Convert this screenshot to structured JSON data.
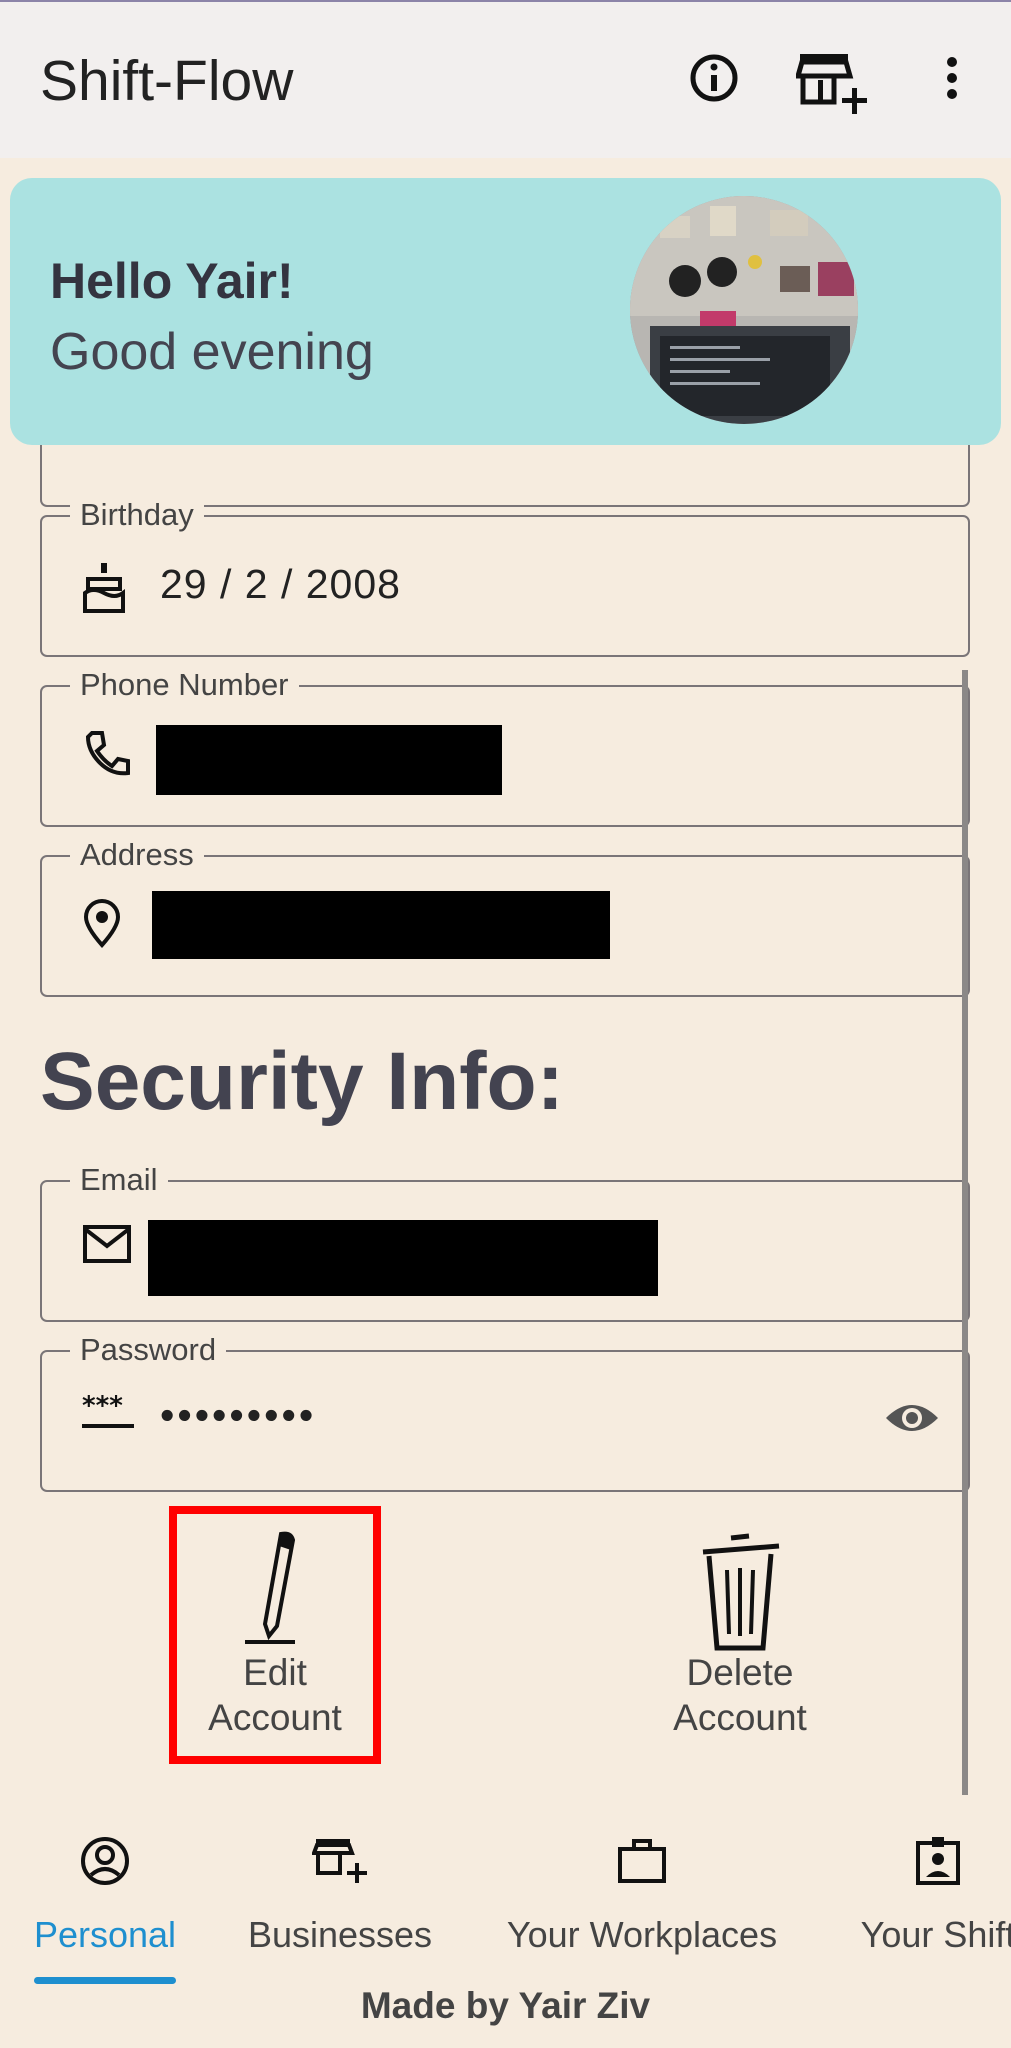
{
  "app": {
    "title": "Shift-Flow"
  },
  "top_icons": [
    "info-icon",
    "store-add-icon",
    "more-vert-icon"
  ],
  "greeting": {
    "hello": "Hello Yair!",
    "sub": "Good evening"
  },
  "fields": {
    "birthday": {
      "label": "Birthday",
      "value": "29 / 2 / 2008",
      "icon": "cake-icon"
    },
    "phone": {
      "label": "Phone Number",
      "value": "",
      "icon": "phone-icon"
    },
    "address": {
      "label": "Address",
      "value": "",
      "icon": "location-pin-icon"
    },
    "email": {
      "label": "Email",
      "value": "",
      "icon": "mail-icon"
    },
    "password": {
      "label": "Password",
      "value": "•••••••••",
      "icon": "password-icon",
      "toggle_icon": "eye-icon"
    }
  },
  "security": {
    "title": "Security Info:"
  },
  "actions": {
    "edit": {
      "line1": "Edit",
      "line2": "Account",
      "icon": "pen-icon"
    },
    "delete": {
      "line1": "Delete",
      "line2": "Account",
      "icon": "trash-icon"
    }
  },
  "nav": {
    "items": [
      {
        "label": "Personal",
        "icon": "account-circle-icon",
        "active": true
      },
      {
        "label": "Businesses",
        "icon": "store-add-icon",
        "active": false
      },
      {
        "label": "Your Workplaces",
        "icon": "briefcase-icon",
        "active": false
      },
      {
        "label": "Your Shift",
        "icon": "badge-icon",
        "active": false
      }
    ]
  },
  "footer": {
    "text": "Made by Yair Ziv"
  },
  "colors": {
    "accent": "#1e8fcf",
    "card": "#abe2e1",
    "background": "#f6ecdf",
    "highlight": "#ff0000"
  }
}
